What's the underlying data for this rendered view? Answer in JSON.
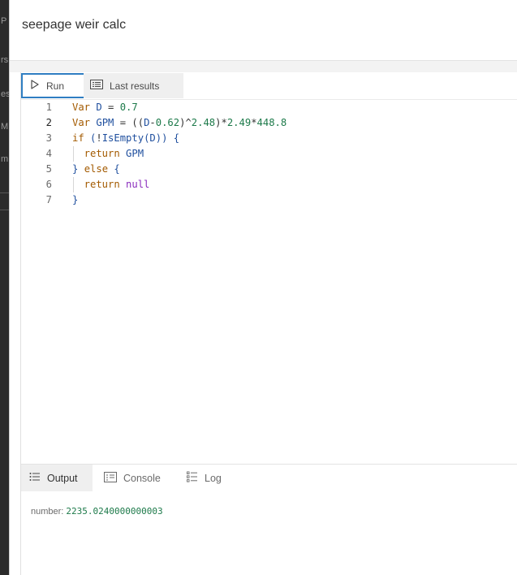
{
  "window": {
    "title": "seepage weir calc"
  },
  "left_strip_chars": [
    "P",
    "rs",
    "es",
    "M",
    "m"
  ],
  "toolbar": {
    "run_label": "Run",
    "last_results_label": "Last results"
  },
  "code_lines": [
    {
      "num": "1",
      "tokens": [
        [
          "kw",
          "Var "
        ],
        [
          "id",
          "D"
        ],
        [
          "op",
          " = "
        ],
        [
          "num",
          "0.7"
        ]
      ]
    },
    {
      "num": "2",
      "tokens": [
        [
          "kw",
          "Var "
        ],
        [
          "id",
          "GPM"
        ],
        [
          "op",
          " = (("
        ],
        [
          "id",
          "D"
        ],
        [
          "op",
          "-"
        ],
        [
          "num",
          "0.62"
        ],
        [
          "op",
          ")^"
        ],
        [
          "num",
          "2.48"
        ],
        [
          "op",
          ")*"
        ],
        [
          "num",
          "2.49"
        ],
        [
          "op",
          "*"
        ],
        [
          "num",
          "448.8"
        ]
      ]
    },
    {
      "num": "3",
      "tokens": [
        [
          "kw",
          "if "
        ],
        [
          "br",
          "("
        ],
        [
          "op",
          "!"
        ],
        [
          "fn",
          "IsEmpty"
        ],
        [
          "br",
          "("
        ],
        [
          "id",
          "D"
        ],
        [
          "br",
          "))"
        ],
        [
          "op",
          " "
        ],
        [
          "br",
          "{"
        ]
      ]
    },
    {
      "num": "4",
      "tokens": [
        [
          "kw",
          "  return "
        ],
        [
          "id",
          "GPM"
        ]
      ]
    },
    {
      "num": "5",
      "tokens": [
        [
          "br",
          "} "
        ],
        [
          "kw",
          "else "
        ],
        [
          "br",
          "{"
        ]
      ]
    },
    {
      "num": "6",
      "tokens": [
        [
          "kw",
          "  return "
        ],
        [
          "kw2",
          "null"
        ]
      ]
    },
    {
      "num": "7",
      "tokens": [
        [
          "br",
          "}"
        ]
      ]
    }
  ],
  "active_line": "2",
  "bottom_tabs": {
    "output": "Output",
    "console": "Console",
    "log": "Log"
  },
  "output": {
    "type_label": "number: ",
    "value": "2235.0240000000003"
  },
  "colors": {
    "accent": "#2f7ec2",
    "keyword": "#a35a00",
    "identifier": "#1f4f9e",
    "number": "#1d7a4a",
    "null": "#8a2dbd"
  }
}
